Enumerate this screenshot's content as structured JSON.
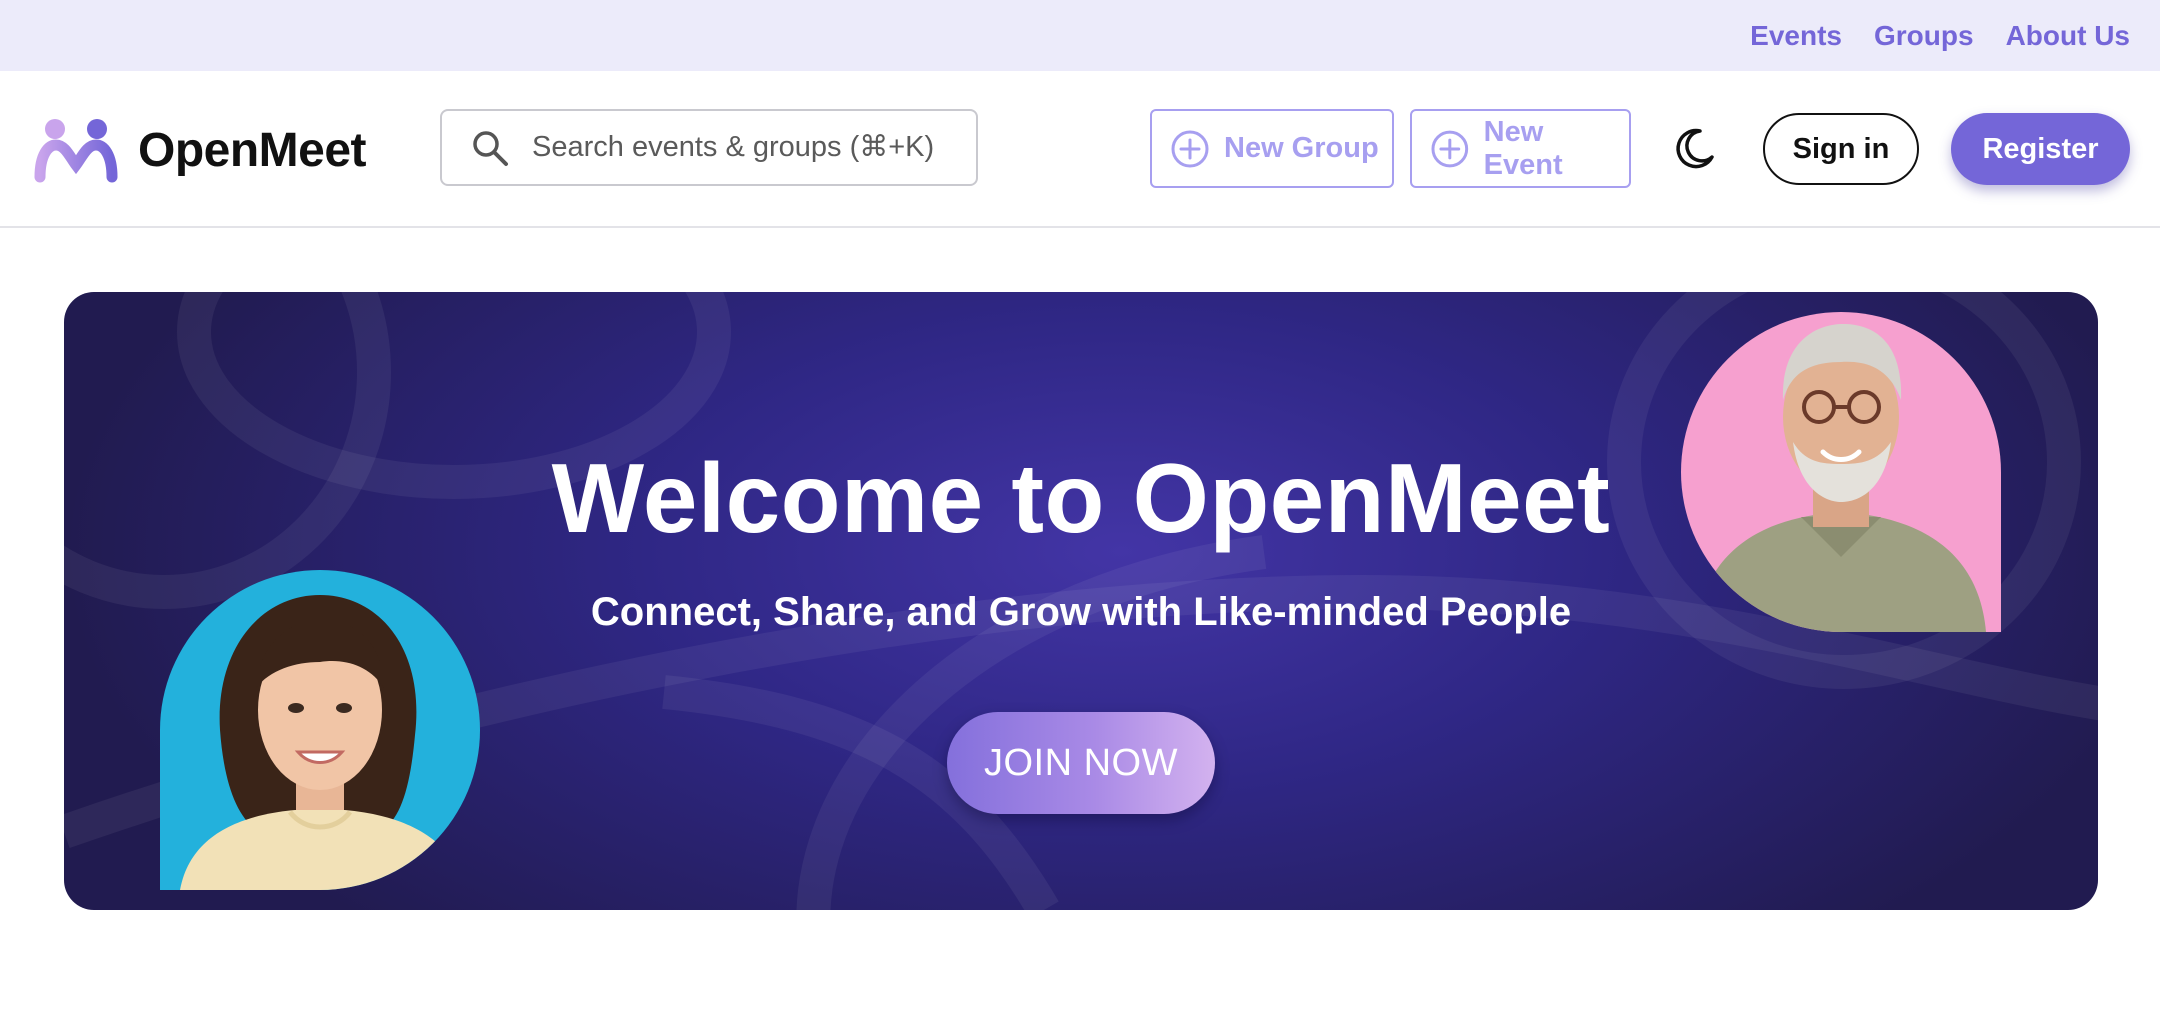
{
  "top_nav": {
    "links": [
      {
        "label": "Events"
      },
      {
        "label": "Groups"
      },
      {
        "label": "About Us"
      }
    ]
  },
  "header": {
    "brand": "OpenMeet",
    "search": {
      "placeholder": "Search events & groups (⌘+K)",
      "value": "",
      "icon": "search-icon"
    },
    "new_group_label": "New Group",
    "new_event_label": "New Event",
    "theme_toggle_icon": "moon-icon",
    "signin_label": "Sign in",
    "register_label": "Register"
  },
  "hero": {
    "title": "Welcome to OpenMeet",
    "subtitle": "Connect, Share, and Grow with Like-minded People",
    "cta_label": "JOIN NOW",
    "left_photo": "smiling-young-woman-photo",
    "right_photo": "smiling-older-man-photo"
  },
  "colors": {
    "accent": "#7466d8",
    "accent_light": "#a79ff0",
    "topbar_bg": "#ecebfa",
    "hero_dark": "#211b50",
    "hero_center": "#4335a6",
    "left_photo_bg": "#23b1dc",
    "right_photo_bg": "#f6a0cf"
  }
}
